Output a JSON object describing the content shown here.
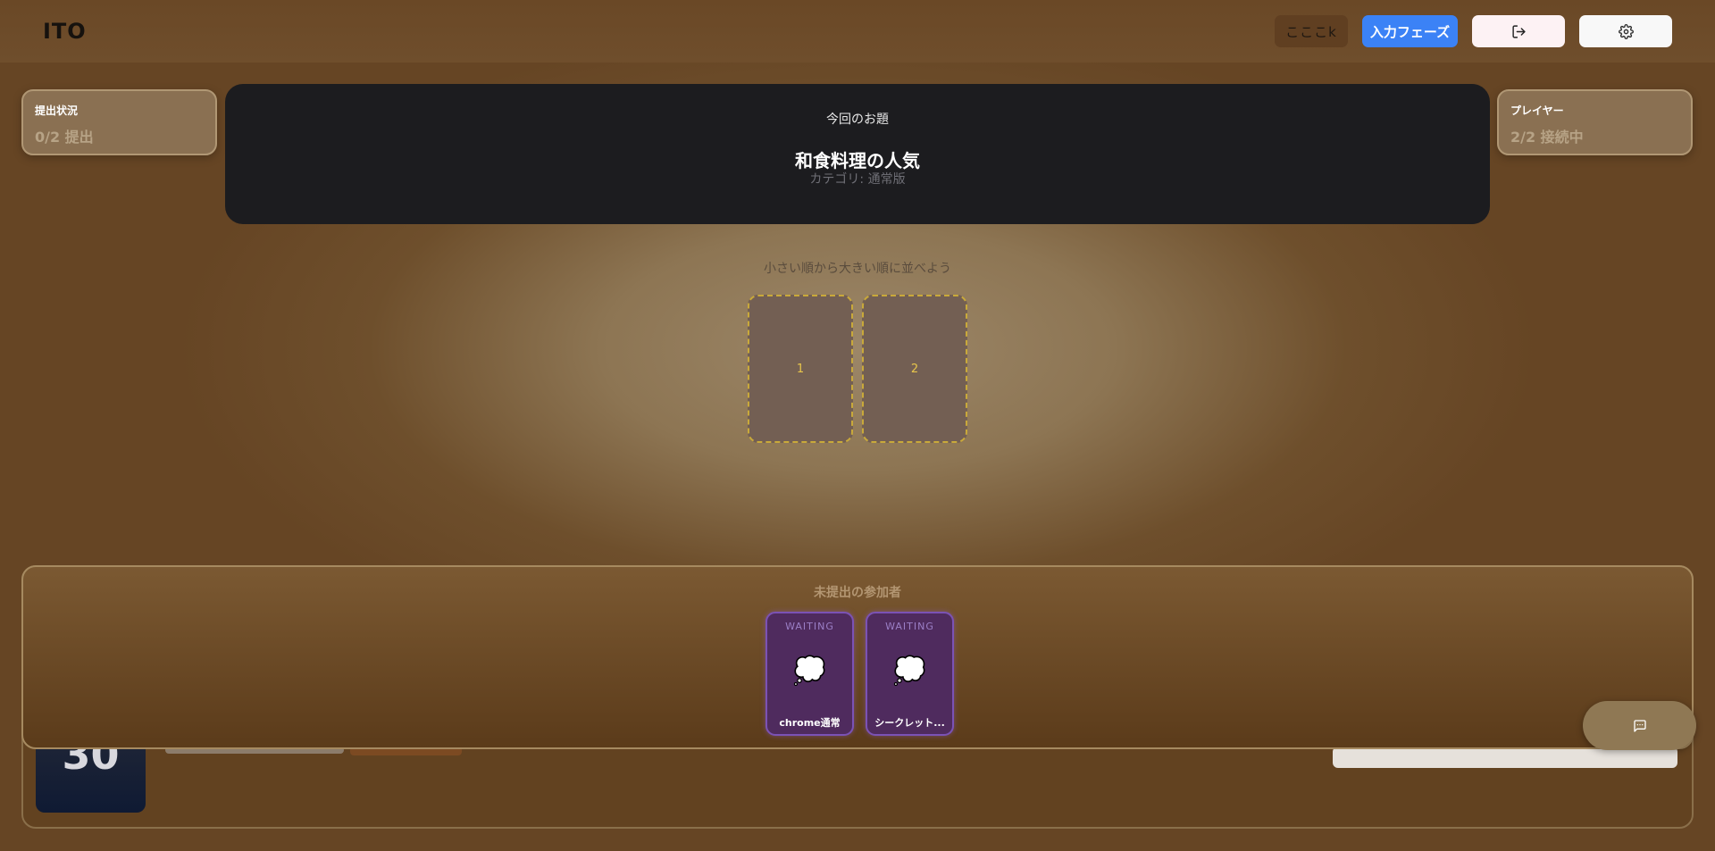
{
  "app": {
    "logo": "ITO"
  },
  "header": {
    "username": "こここk",
    "phase_button": "入力フェーズ",
    "exit_icon": "logout-icon",
    "settings_icon": "gear-icon"
  },
  "status": {
    "label": "提出状況",
    "value": "0/2 提出"
  },
  "players": {
    "label": "プレイヤー",
    "value": "2/2 接続中"
  },
  "topic": {
    "heading": "今回のお題",
    "title": "和食料理の人気",
    "category": "カテゴリ: 通常版"
  },
  "board": {
    "instruction": "小さい順から大きい順に並べよう",
    "slots": [
      "1",
      "2"
    ]
  },
  "unsubmitted": {
    "title": "未提出の参加者",
    "participants": [
      {
        "status": "WAITING",
        "icon": "thought-bubble-icon",
        "glyph": "💭",
        "name": "chrome通常"
      },
      {
        "status": "WAITING",
        "icon": "thought-bubble-icon",
        "glyph": "💭",
        "name": "シークレット..."
      }
    ]
  },
  "timer": {
    "value": "30"
  },
  "chat": {
    "icon": "chat-icon"
  },
  "colors": {
    "accent": "#3b82f6",
    "panel": "#1c1c1f",
    "waiting_card": "#4f2b5e"
  }
}
